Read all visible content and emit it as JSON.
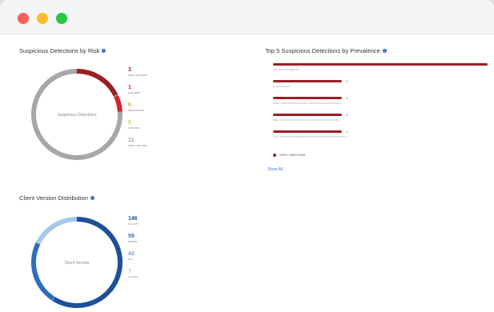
{
  "window": {
    "controls": [
      "close",
      "minimize",
      "maximize"
    ],
    "colors": {
      "close": "#fe5f57",
      "minimize": "#febc2e",
      "maximize": "#28c840"
    }
  },
  "risk_panel": {
    "title": "Suspicious Detections by Risk",
    "center_label": "Suspicious Detections",
    "legend": [
      {
        "count": "3",
        "label": "VERY HIGH RISK",
        "color": "#9c1f24"
      },
      {
        "count": "1",
        "label": "HIGH RISK",
        "color": "#d8202a"
      },
      {
        "count": "6",
        "label": "MEDIUM RISK",
        "color": "#e8a33a"
      },
      {
        "count": "0",
        "label": "LOW RISK",
        "color": "#c9d64a"
      },
      {
        "count": "11",
        "label": "VERY LOW RISK",
        "color": "#a0a0a0"
      }
    ]
  },
  "prevalence_panel": {
    "title": "Top 5 Suspicious Detections by Prevalence",
    "items": [
      {
        "count": "",
        "share": 1.0,
        "text": "Host: a0c-1-XXXX06E1.TXT"
      },
      {
        "count": "1",
        "share": 0.32,
        "text": "Proxyl.exe.XXXXX"
      },
      {
        "count": "1",
        "share": 0.32,
        "text": "Seldon / XXXXXXXXXXXX.XXX.XXX / XXXXXX.XXX.XXX.XXXXX.XXXX"
      },
      {
        "count": "1",
        "share": 0.32,
        "text": "Seldon / XXXXXXXXXXXXXXXXXXX / XXXXX.XXX.XXX.XXXXXXXXX"
      },
      {
        "count": "1",
        "share": 0.32,
        "text": "Cmd / XXXXXXXX / XXXXXXXXXXXXX.XXX.XXXX.XXXXXXXX.XXX.XXXXX.X"
      }
    ],
    "legend_label": "VERY HIGH RISK",
    "legend_color": "#9c1f24",
    "show_all": "Show All"
  },
  "client_panel": {
    "title": "Client Version Distribution",
    "center_label": "Client Version",
    "legend": [
      {
        "count": "146",
        "label": "16.0 OPT",
        "color": "#1f4f99"
      },
      {
        "count": "59",
        "label": "EPRIME",
        "color": "#2f6ebd"
      },
      {
        "count": "43",
        "label": "16.0",
        "color": "#6ea3d9"
      },
      {
        "count": "7",
        "label": "16.2 ELD",
        "color": "#a5c8ec"
      }
    ]
  }
}
